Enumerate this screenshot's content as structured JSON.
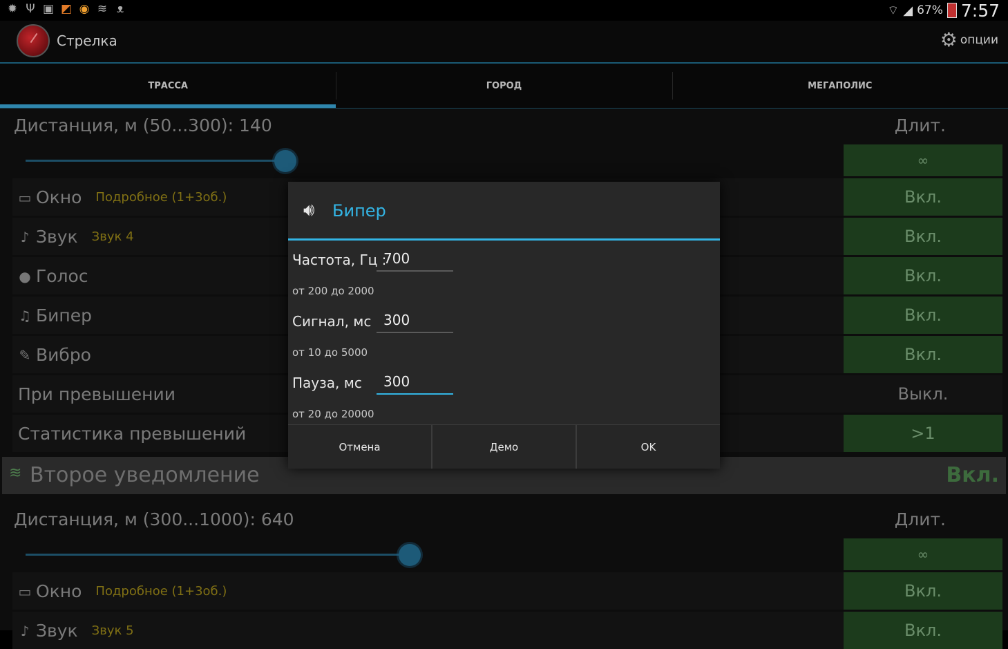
{
  "statusbar": {
    "left_icons": [
      "bug-icon",
      "usb-icon",
      "image-icon",
      "rss-icon",
      "app-icon",
      "network-icon",
      "cat-icon"
    ],
    "battery_pct": "67%",
    "time": "7:57"
  },
  "actionbar": {
    "title": "Стрелка",
    "options_label": "опции"
  },
  "tabs": [
    {
      "label": "ТРАССА",
      "active": true
    },
    {
      "label": "ГОРОД",
      "active": false
    },
    {
      "label": "МЕГАПОЛИС",
      "active": false
    }
  ],
  "section1": {
    "distance_label": "Дистанция, м (50...300): 140",
    "duration_header": "Длит.",
    "slider_value": 140,
    "slider_min": 50,
    "slider_max": 300,
    "infinity": "∞",
    "rows": [
      {
        "label": "Окно",
        "sub": "Подробное (1+3об.)",
        "value": "Вкл.",
        "icon": "window-icon"
      },
      {
        "label": "Звук",
        "sub": "Звук 4",
        "value": "Вкл.",
        "icon": "bell-icon"
      },
      {
        "label": "Голос",
        "sub": "",
        "value": "Вкл.",
        "icon": "mic-icon"
      },
      {
        "label": "Бипер",
        "sub": "",
        "value": "Вкл.",
        "icon": "music-icon"
      },
      {
        "label": "Вибро",
        "sub": "",
        "value": "Вкл.",
        "icon": "vibrate-icon"
      }
    ],
    "exceed_label": "При превышении",
    "exceed_value": "Выкл.",
    "stats_label": "Статистика превышений",
    "stats_value": ">1"
  },
  "section2": {
    "title": "Второе уведомление",
    "value": "Вкл.",
    "distance_label": "Дистанция, м (300...1000): 640",
    "duration_header": "Длит.",
    "slider_value": 640,
    "slider_min": 300,
    "slider_max": 1000,
    "infinity": "∞",
    "rows": [
      {
        "label": "Окно",
        "sub": "Подробное (1+3об.)",
        "value": "Вкл.",
        "icon": "window-icon"
      },
      {
        "label": "Звук",
        "sub": "Звук 5",
        "value": "Вкл.",
        "icon": "bell-icon"
      }
    ]
  },
  "dialog": {
    "title": "Бипер",
    "fields": [
      {
        "label": "Частота, Гц :",
        "value": "700",
        "hint": "от 200 до 2000"
      },
      {
        "label": "Сигнал, мс",
        "value": "300",
        "hint": "от 10 до 5000"
      },
      {
        "label": "Пауза, мс",
        "value": "300",
        "hint": "от 20 до 20000"
      }
    ],
    "buttons": {
      "cancel": "Отмена",
      "demo": "Демо",
      "ok": "OK"
    }
  },
  "colors": {
    "accent": "#33b5e5",
    "green_cell": "#1c3b1c",
    "tab_indicator": "#2f86ad"
  }
}
